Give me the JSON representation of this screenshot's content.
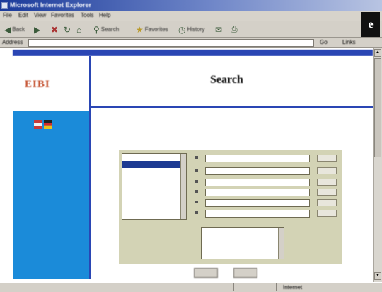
{
  "window": {
    "title": "Microsoft Internet Explorer"
  },
  "menu": [
    "File",
    "Edit",
    "View",
    "Favorites",
    "Tools",
    "Help"
  ],
  "toolbar": {
    "back": "Back",
    "forward": "",
    "stop": "",
    "refresh": "",
    "home": "",
    "search": "Search",
    "favorites": "Favorites",
    "history": "History",
    "mail": "",
    "print": ""
  },
  "address": {
    "label": "Address",
    "value": "",
    "go": "Go",
    "links": "Links"
  },
  "topnav": {
    "text": ""
  },
  "logo": {
    "text": "EIBI"
  },
  "header": {
    "title": "Search"
  },
  "sidebar": {
    "links": [
      "",
      "",
      "",
      "",
      "",
      "",
      "",
      ""
    ]
  },
  "intro": {
    "text": ""
  },
  "form": {
    "list_items": [
      "",
      "",
      "",
      "",
      "",
      "",
      "",
      "",
      ""
    ],
    "labels": {
      "row_a": "",
      "row_b": ""
    },
    "select_items": [
      "",
      "",
      "",
      ""
    ]
  },
  "buttons": {
    "submit": "",
    "reset": ""
  },
  "status": {
    "left": "",
    "zone": "Internet"
  },
  "colors": {
    "nav_blue": "#2a46b4",
    "sidebar_blue": "#1b8bd9",
    "form_panel": "#d3d3b5",
    "logo": "#c4502e"
  }
}
